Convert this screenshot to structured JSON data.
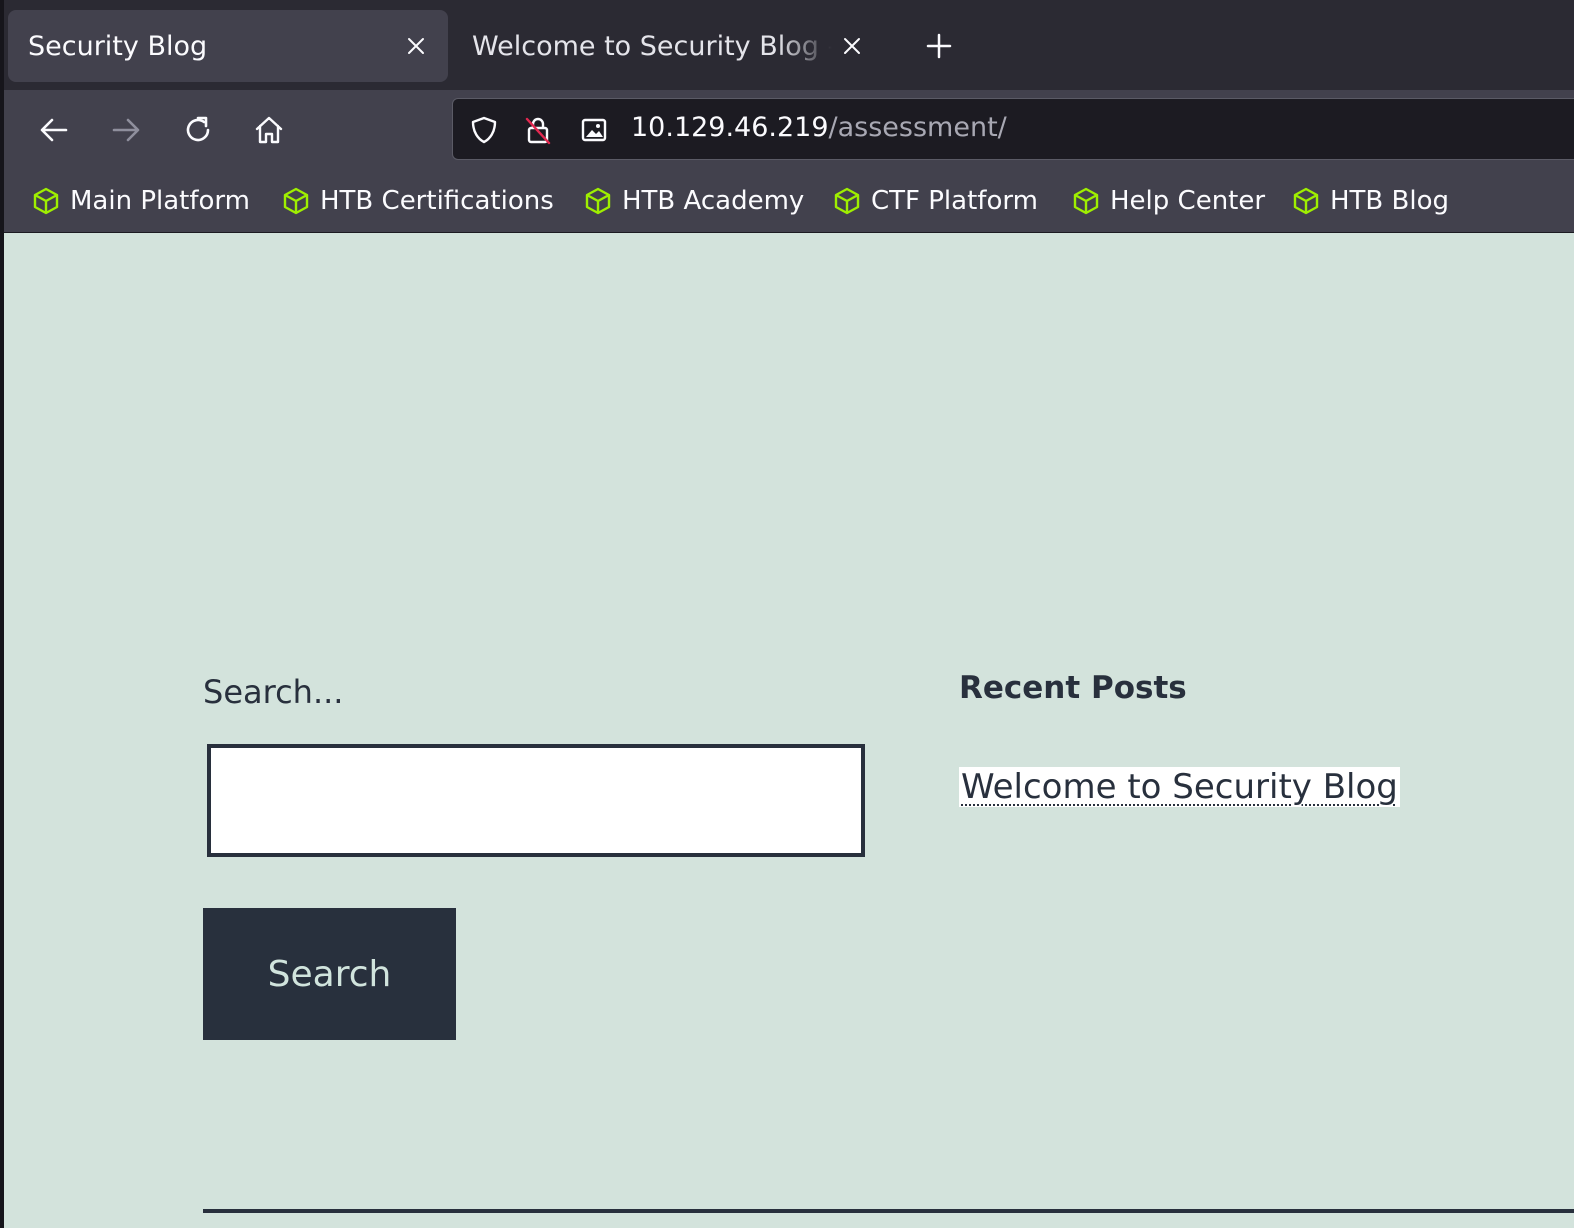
{
  "browser": {
    "tabs": [
      {
        "title": "Security Blog",
        "active": true
      },
      {
        "title": "Welcome to Security Blog – Security Blog",
        "active": false
      }
    ],
    "url": {
      "host": "10.129.46.219",
      "path": "/assessment/"
    },
    "bookmarks": [
      {
        "label": "Main Platform",
        "icon": "cube-icon"
      },
      {
        "label": "HTB Certifications",
        "icon": "cube-icon"
      },
      {
        "label": "HTB Academy",
        "icon": "cube-icon"
      },
      {
        "label": "CTF Platform",
        "icon": "cube-icon"
      },
      {
        "label": "Help Center",
        "icon": "cube-icon"
      },
      {
        "label": "HTB Blog",
        "icon": "cube-icon"
      }
    ]
  },
  "page": {
    "search": {
      "label": "Search...",
      "value": "",
      "button_label": "Search"
    },
    "recent_posts": {
      "heading": "Recent Posts",
      "items": [
        "Welcome to Security Blog"
      ]
    }
  },
  "colors": {
    "page_background": "#d3e3dc",
    "text_dark": "#28303d",
    "bookmark_icon": "#9fef00",
    "tab_active": "#42414d",
    "tabstrip": "#2b2a33"
  }
}
